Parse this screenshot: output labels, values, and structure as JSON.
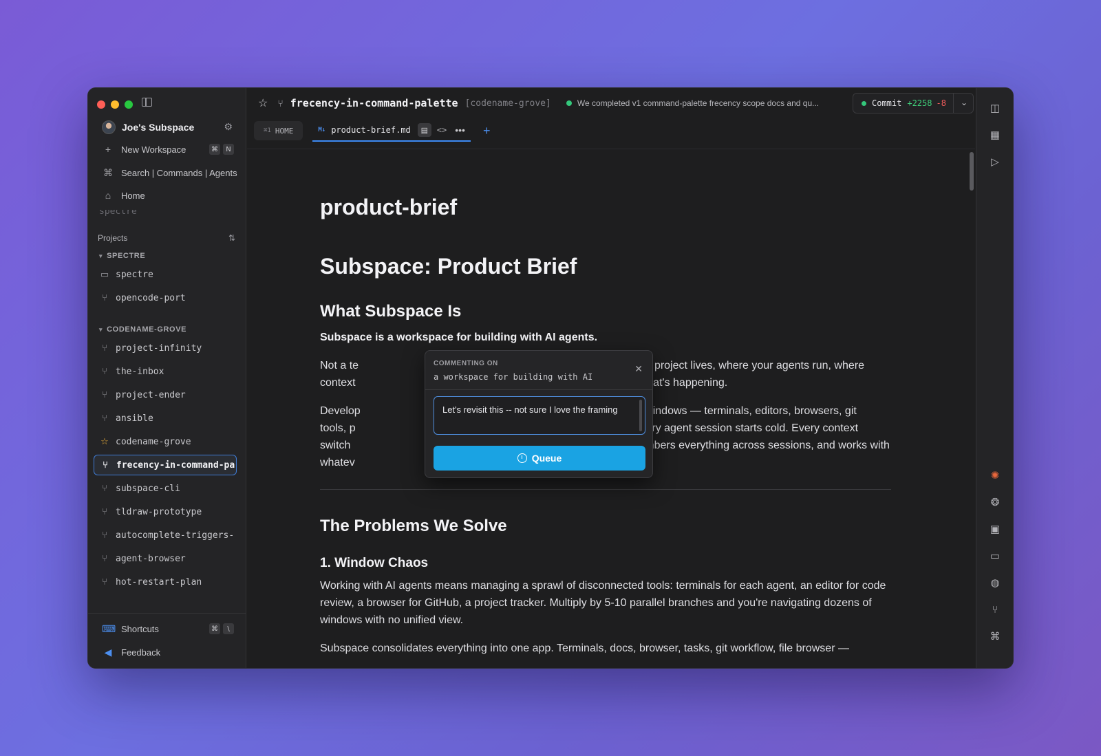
{
  "window": {
    "title": "frecency-in-command-palette",
    "codename": "[codename-grove]",
    "status_message": "We completed v1 command-palette frecency scope docs and qu...",
    "commit": {
      "label": "Commit",
      "additions": "+2258",
      "deletions": "-8"
    }
  },
  "sidebar": {
    "workspace_name": "Joe's Subspace",
    "new_workspace": {
      "label": "New Workspace",
      "shortcut": [
        "⌘",
        "N"
      ]
    },
    "search_label": "Search | Commands | Agents",
    "home_label": "Home",
    "faded_item": "spectre",
    "projects_label": "Projects",
    "groups": [
      {
        "name": "SPECTRE",
        "items": [
          "spectre",
          "opencode-port"
        ]
      },
      {
        "name": "CODENAME-GROVE",
        "items": [
          "project-infinity",
          "the-inbox",
          "project-ender",
          "ansible",
          "codename-grove",
          "frecency-in-command-pa",
          "subspace-cli",
          "tldraw-prototype",
          "autocomplete-triggers-",
          "agent-browser",
          "hot-restart-plan"
        ]
      }
    ],
    "shortcuts": {
      "label": "Shortcuts",
      "keys": [
        "⌘",
        "\\"
      ]
    },
    "feedback": "Feedback"
  },
  "tabs": {
    "home": {
      "num": "⌘1",
      "label": "HOME"
    },
    "active": {
      "badge": "M↓",
      "label": "product-brief.md"
    }
  },
  "document": {
    "title": "product-brief",
    "h1": "Subspace: Product Brief",
    "sec1_heading": "What Subspace Is",
    "sec1_lead": "Subspace is a workspace for building with AI agents.",
    "p1_line1": "Not a te",
    "p1_line1_end": "e where your project lives, where your agents run, where",
    "p1_line2": "context",
    "p1_line2_end": "to find out what's happening.",
    "p2_line1": "Develop",
    "p2_line1_end": "across 30+ windows — terminals, editors, browsers, git",
    "p2_line2": "tools, p",
    "p2_line2_end": "ied view. Every agent session starts cold. Every context",
    "p2_line3": "switch",
    "p2_line3_end": "ce, remembers everything across sessions, and works with",
    "p2_line4": "whatev",
    "sec2_heading": "The Problems We Solve",
    "sec2_sub": "1. Window Chaos",
    "p3": "Working with AI agents means managing a sprawl of disconnected tools: terminals for each agent, an editor for code review, a browser for GitHub, a project tracker. Multiply by 5-10 parallel branches and you're navigating dozens of windows with no unified view.",
    "p4": "Subspace consolidates everything into one app. Terminals, docs, browser, tasks, git workflow, file browser —"
  },
  "comment_popup": {
    "label": "COMMENTING ON",
    "quote": "a workspace for building with AI",
    "input_value": "Let's revisit this -- not sure I love the framing",
    "button_label": "Queue"
  },
  "colors": {
    "accent": "#3d8bf5",
    "queue_button": "#1aa3e3",
    "status_green": "#34c77b",
    "deletion_red": "#ef5b5b"
  }
}
